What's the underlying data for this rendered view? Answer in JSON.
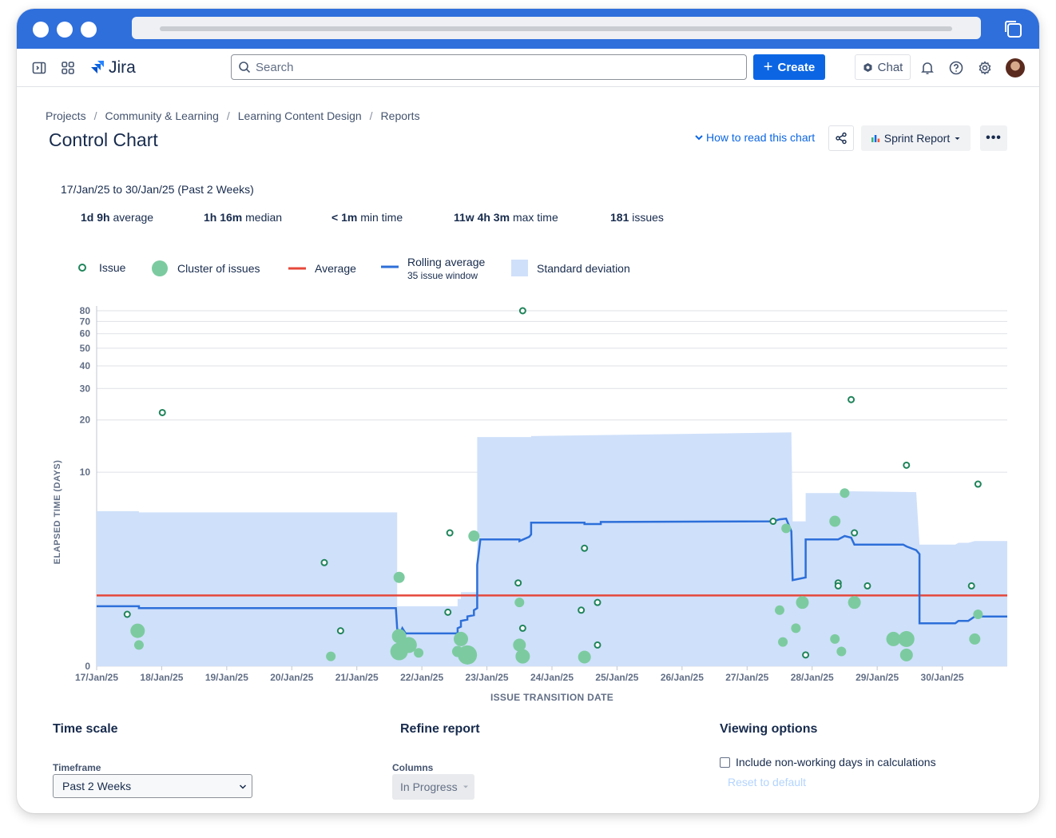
{
  "app": {
    "name": "Jira"
  },
  "colors": {
    "titlebar": "#2f6fdc",
    "primary": "#0c66e4",
    "issue_dot": "#1f845a",
    "cluster": "#7ccba0",
    "average_line": "#e5483b",
    "rolling_line": "#2d6fd9",
    "std_dev": "#cfe0fa"
  },
  "topnav": {
    "search_placeholder": "Search",
    "create_label": "Create",
    "chat_label": "Chat",
    "icons": [
      "sidebar-toggle-icon",
      "app-switcher-icon",
      "jira-logo-icon",
      "notifications-icon",
      "help-icon",
      "settings-icon"
    ]
  },
  "breadcrumb": [
    "Projects",
    "Community & Learning",
    "Learning Content Design",
    "Reports"
  ],
  "page": {
    "title": "Control Chart",
    "how_to_read": "How to read this chart",
    "report_select": "Sprint Report",
    "more_label": "•••"
  },
  "summary": {
    "date_range": "17/Jan/25 to 30/Jan/25 (Past 2 Weeks)",
    "stats": [
      {
        "value": "1d 9h",
        "label": "average"
      },
      {
        "value": "1h 16m",
        "label": "median"
      },
      {
        "value": "< 1m",
        "label": "min time"
      },
      {
        "value": "11w 4h 3m",
        "label": "max time"
      },
      {
        "value": "181",
        "label": "issues"
      }
    ]
  },
  "legend": {
    "issue": "Issue",
    "cluster": "Cluster of issues",
    "average": "Average",
    "rolling": "Rolling average",
    "rolling_sub": "35 issue window",
    "stddev": "Standard deviation"
  },
  "chart_data": {
    "type": "scatter",
    "title": "",
    "xlabel": "ISSUE TRANSITION DATE",
    "ylabel": "ELAPSED TIME (DAYS)",
    "y_scale": "log-like",
    "y_ticks": [
      0,
      10,
      20,
      30,
      40,
      50,
      60,
      70,
      80
    ],
    "x_ticks": [
      "17/Jan/25",
      "18/Jan/25",
      "19/Jan/25",
      "20/Jan/25",
      "21/Jan/25",
      "22/Jan/25",
      "23/Jan/25",
      "24/Jan/25",
      "25/Jan/25",
      "26/Jan/25",
      "27/Jan/25",
      "28/Jan/25",
      "29/Jan/25",
      "30/Jan/25"
    ],
    "x_range_days": [
      0,
      14
    ],
    "grid": true,
    "average_days": 1.4,
    "issues": [
      {
        "x": 0.47,
        "y": 0.9
      },
      {
        "x": 1.01,
        "y": 22
      },
      {
        "x": 3.5,
        "y": 2.6
      },
      {
        "x": 3.75,
        "y": 0.55
      },
      {
        "x": 5.43,
        "y": 4.2
      },
      {
        "x": 5.4,
        "y": 0.95
      },
      {
        "x": 6.48,
        "y": 1.8
      },
      {
        "x": 6.55,
        "y": 80
      },
      {
        "x": 6.55,
        "y": 0.6
      },
      {
        "x": 7.5,
        "y": 3.3
      },
      {
        "x": 7.45,
        "y": 1.0
      },
      {
        "x": 7.7,
        "y": 1.2
      },
      {
        "x": 7.7,
        "y": 0.3
      },
      {
        "x": 10.4,
        "y": 5.0
      },
      {
        "x": 10.9,
        "y": 0.15
      },
      {
        "x": 11.6,
        "y": 26
      },
      {
        "x": 11.65,
        "y": 4.2
      },
      {
        "x": 11.4,
        "y": 1.8
      },
      {
        "x": 11.85,
        "y": 1.7
      },
      {
        "x": 12.45,
        "y": 11
      },
      {
        "x": 13.55,
        "y": 8.5
      },
      {
        "x": 13.45,
        "y": 1.7
      },
      {
        "x": 11.4,
        "y": 1.7
      }
    ],
    "clusters": [
      {
        "x": 0.63,
        "y": 0.55,
        "r": 9
      },
      {
        "x": 0.65,
        "y": 0.3,
        "r": 6
      },
      {
        "x": 3.6,
        "y": 0.13,
        "r": 6
      },
      {
        "x": 4.65,
        "y": 2.0,
        "r": 7
      },
      {
        "x": 4.65,
        "y": 0.45,
        "r": 9
      },
      {
        "x": 4.65,
        "y": 0.2,
        "r": 11
      },
      {
        "x": 4.95,
        "y": 0.18,
        "r": 6
      },
      {
        "x": 4.8,
        "y": 0.3,
        "r": 10
      },
      {
        "x": 5.6,
        "y": 0.4,
        "r": 9
      },
      {
        "x": 5.7,
        "y": 0.15,
        "r": 12
      },
      {
        "x": 5.55,
        "y": 0.2,
        "r": 7
      },
      {
        "x": 5.8,
        "y": 4.0,
        "r": 7
      },
      {
        "x": 6.5,
        "y": 1.2,
        "r": 6
      },
      {
        "x": 6.5,
        "y": 0.3,
        "r": 8
      },
      {
        "x": 6.55,
        "y": 0.13,
        "r": 9
      },
      {
        "x": 7.5,
        "y": 0.12,
        "r": 8
      },
      {
        "x": 10.5,
        "y": 1.0,
        "r": 6
      },
      {
        "x": 10.6,
        "y": 4.5,
        "r": 6
      },
      {
        "x": 10.85,
        "y": 1.2,
        "r": 8
      },
      {
        "x": 10.75,
        "y": 0.6,
        "r": 6
      },
      {
        "x": 10.55,
        "y": 0.35,
        "r": 6
      },
      {
        "x": 11.5,
        "y": 7.5,
        "r": 6
      },
      {
        "x": 11.35,
        "y": 5.0,
        "r": 7
      },
      {
        "x": 11.65,
        "y": 1.2,
        "r": 8
      },
      {
        "x": 11.35,
        "y": 0.4,
        "r": 6
      },
      {
        "x": 11.45,
        "y": 0.2,
        "r": 6
      },
      {
        "x": 12.25,
        "y": 0.4,
        "r": 9
      },
      {
        "x": 12.45,
        "y": 0.4,
        "r": 10
      },
      {
        "x": 12.45,
        "y": 0.15,
        "r": 8
      },
      {
        "x": 13.5,
        "y": 0.4,
        "r": 7
      },
      {
        "x": 13.55,
        "y": 0.9,
        "r": 6
      }
    ],
    "rolling_average": [
      [
        0,
        1.1
      ],
      [
        0.65,
        1.1
      ],
      [
        0.65,
        1.05
      ],
      [
        3.5,
        1.05
      ],
      [
        4.6,
        1.05
      ],
      [
        4.62,
        0.6
      ],
      [
        4.65,
        0.45
      ],
      [
        4.7,
        0.6
      ],
      [
        4.75,
        0.5
      ],
      [
        5.55,
        0.5
      ],
      [
        5.55,
        0.6
      ],
      [
        5.6,
        0.63
      ],
      [
        5.6,
        0.75
      ],
      [
        5.7,
        0.78
      ],
      [
        5.7,
        0.85
      ],
      [
        5.8,
        0.88
      ],
      [
        5.8,
        1.0
      ],
      [
        5.85,
        1.05
      ],
      [
        5.85,
        2.5
      ],
      [
        5.9,
        3.8
      ],
      [
        6.5,
        3.8
      ],
      [
        6.5,
        3.7
      ],
      [
        6.65,
        3.95
      ],
      [
        6.68,
        4.1
      ],
      [
        6.68,
        4.9
      ],
      [
        7.5,
        4.9
      ],
      [
        7.5,
        4.8
      ],
      [
        7.75,
        4.8
      ],
      [
        7.75,
        4.95
      ],
      [
        10.4,
        5.0
      ],
      [
        10.5,
        5.15
      ],
      [
        10.6,
        5.2
      ],
      [
        10.68,
        4.3
      ],
      [
        10.7,
        1.9
      ],
      [
        10.9,
        2.0
      ],
      [
        10.9,
        3.8
      ],
      [
        11.4,
        3.8
      ],
      [
        11.5,
        4.0
      ],
      [
        11.6,
        3.9
      ],
      [
        11.65,
        3.5
      ],
      [
        12.4,
        3.5
      ],
      [
        12.45,
        3.4
      ],
      [
        12.6,
        3.2
      ],
      [
        12.65,
        3.0
      ],
      [
        12.65,
        0.7
      ],
      [
        13.2,
        0.7
      ],
      [
        13.25,
        0.75
      ],
      [
        13.4,
        0.75
      ],
      [
        13.5,
        0.85
      ],
      [
        14,
        0.85
      ]
    ],
    "std_dev_band": [
      [
        0,
        5.8
      ],
      [
        0.65,
        5.8
      ],
      [
        0.65,
        5.7
      ],
      [
        4.62,
        5.7
      ],
      [
        4.62,
        1.1
      ],
      [
        5.55,
        1.1
      ],
      [
        5.55,
        1.3
      ],
      [
        5.6,
        1.3
      ],
      [
        5.6,
        1.5
      ],
      [
        5.85,
        1.5
      ],
      [
        5.85,
        16
      ],
      [
        6.68,
        16
      ],
      [
        6.68,
        16.2
      ],
      [
        10.68,
        17
      ],
      [
        10.7,
        5.0
      ],
      [
        10.9,
        5.0
      ],
      [
        10.9,
        7.5
      ],
      [
        11.5,
        7.5
      ],
      [
        11.5,
        7.7
      ],
      [
        12.6,
        7.6
      ],
      [
        12.65,
        3.5
      ],
      [
        13.2,
        3.5
      ],
      [
        13.25,
        3.6
      ],
      [
        13.4,
        3.6
      ],
      [
        13.5,
        3.7
      ],
      [
        14,
        3.7
      ]
    ]
  },
  "bottom": {
    "time_scale_title": "Time scale",
    "timeframe_label": "Timeframe",
    "timeframe_value": "Past 2 Weeks",
    "refine_title": "Refine report",
    "columns_label": "Columns",
    "columns_value": "In Progress",
    "viewing_title": "Viewing options",
    "nonworking_label": "Include non-working days in calculations",
    "reset_label": "Reset to default"
  }
}
